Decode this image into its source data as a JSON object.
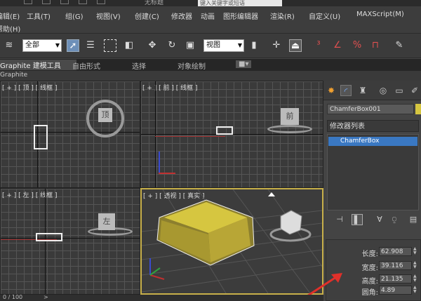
{
  "window": {
    "title": "无标题",
    "search_placeholder": "键入关键字或短语"
  },
  "menu": {
    "items": [
      "编辑(E)",
      "工具(T)",
      "组(G)",
      "视图(V)",
      "创建(C)",
      "修改器",
      "动画",
      "图形编辑器",
      "渲染(R)",
      "自定义(U)",
      "MAXScript(M)"
    ],
    "overflow": "帮助(H)"
  },
  "toolbar": {
    "selection_filter": "全部",
    "ref_coord": "视图"
  },
  "ribbon": {
    "tabs": [
      "Graphite 建模工具",
      "自由形式",
      "选择",
      "对象绘制"
    ],
    "active_tab": 0,
    "strip_label": "Graphite"
  },
  "viewports": {
    "top": "[ + ] [ 顶 ] [ 线框 ]",
    "front": "[ + ] [ 前 ] [ 线框 ]",
    "left": "[ + ] [ 左 ] [ 线框 ]",
    "perspective": "[ + ] [ 透视 ] [ 真实 ]",
    "cube_top": "顶",
    "cube_front": "前",
    "cube_left": "左"
  },
  "panel": {
    "object_name": "ChamferBox001",
    "object_color": "#d6c640",
    "modifier_list": "修改器列表",
    "stack_item": "ChamferBox",
    "params": [
      {
        "label": "长度:",
        "value": "62.908"
      },
      {
        "label": "宽度:",
        "value": "39.116"
      },
      {
        "label": "高度:",
        "value": "21.135"
      },
      {
        "label": "圆角:",
        "value": "4.89"
      }
    ]
  },
  "status": {
    "left": "0 / 100",
    "right": ">"
  },
  "colors": {
    "accent": "#c8b04a",
    "selection": "#3a78c2",
    "arrow": "#e0302a"
  }
}
